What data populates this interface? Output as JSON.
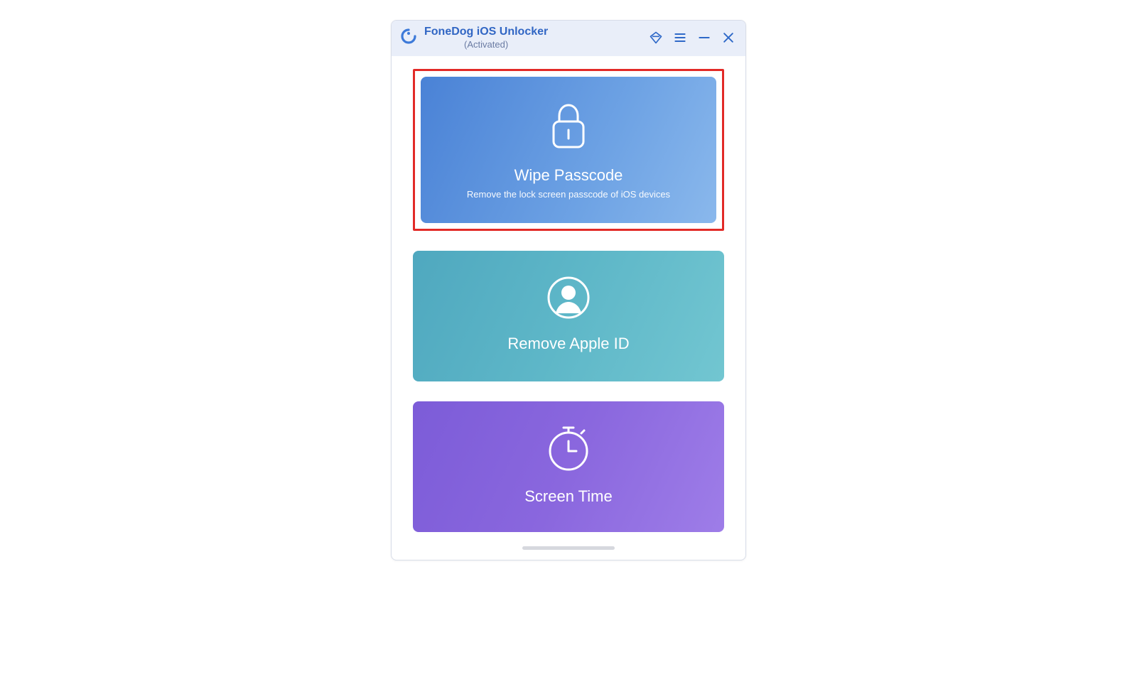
{
  "header": {
    "title": "FoneDog iOS Unlocker",
    "subtitle": "(Activated)"
  },
  "cards": {
    "wipe": {
      "title": "Wipe Passcode",
      "desc": "Remove the lock screen passcode of iOS devices"
    },
    "apple": {
      "title": "Remove Apple ID"
    },
    "screen": {
      "title": "Screen Time"
    }
  }
}
